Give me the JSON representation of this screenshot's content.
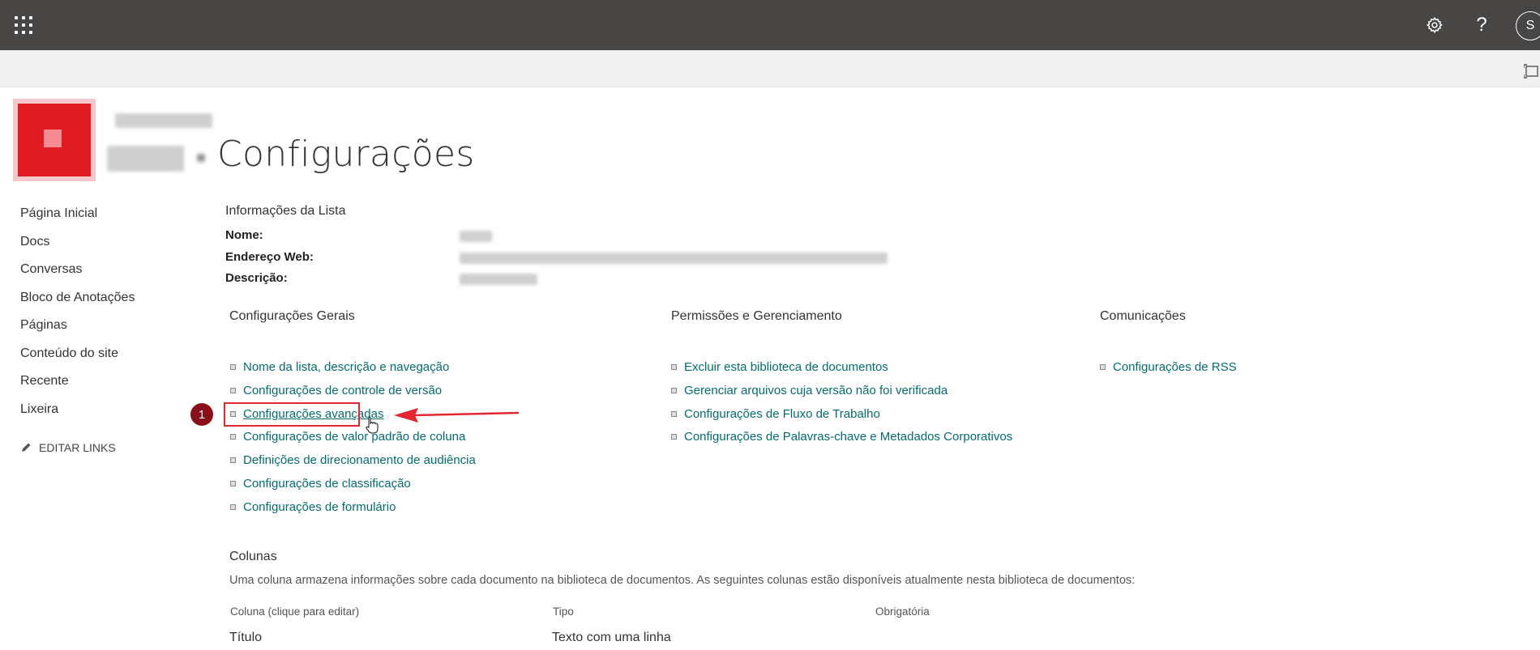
{
  "topbar": {
    "app_launcher_icon": "waffle-icon",
    "settings_icon": "gear-icon",
    "help_label": "?",
    "avatar_initial": "S",
    "background": "#484644"
  },
  "site": {
    "logo_color": "#e11b22",
    "title": "Configurações"
  },
  "leftnav": {
    "items": [
      "Página Inicial",
      "Docs",
      "Conversas",
      "Bloco de Anotações",
      "Páginas",
      "Conteúdo do site",
      "Recente",
      "Lixeira"
    ],
    "edit_links_label": "EDITAR LINKS"
  },
  "list_info": {
    "heading": "Informações da Lista",
    "name_label": "Nome:",
    "web_address_label": "Endereço Web:",
    "description_label": "Descrição:"
  },
  "sections": {
    "general": {
      "title": "Configurações Gerais",
      "links": [
        "Nome da lista, descrição e navegação",
        "Configurações de controle de versão",
        "Configurações avançadas",
        "Configurações de valor padrão de coluna",
        "Definições de direcionamento de audiência",
        "Configurações de classificação",
        "Configurações de formulário"
      ]
    },
    "permissions": {
      "title": "Permissões e Gerenciamento",
      "links": [
        "Excluir esta biblioteca de documentos",
        "Gerenciar arquivos cuja versão não foi verificada",
        "Configurações de Fluxo de Trabalho",
        "Configurações de Palavras-chave e Metadados Corporativos"
      ]
    },
    "communications": {
      "title": "Comunicações",
      "links": [
        "Configurações de RSS"
      ]
    }
  },
  "annotation": {
    "step_number": "1",
    "color": "#e3262f"
  },
  "columns": {
    "title": "Colunas",
    "description": "Uma coluna armazena informações sobre cada documento na biblioteca de documentos. As seguintes colunas estão disponíveis atualmente nesta biblioteca de documentos:",
    "headers": [
      "Coluna (clique para editar)",
      "Tipo",
      "Obrigatória"
    ],
    "rows": [
      [
        "Título",
        "Texto com uma linha",
        ""
      ]
    ]
  },
  "colors": {
    "link": "#036c70",
    "accent": "#e11b22"
  }
}
